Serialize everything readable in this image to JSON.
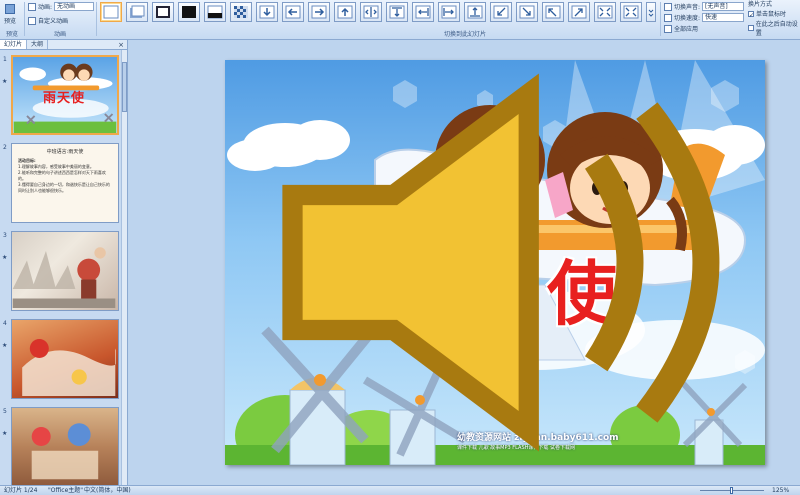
{
  "ribbon": {
    "preview_label": "预览",
    "preview_group": "预览",
    "animations_group": "动画",
    "animate_label": "动画:",
    "animate_value": "无动画",
    "custom_animation_label": "自定义动画",
    "transitions_group": "切换到此幻灯片",
    "sound_label": "切换声音:",
    "sound_value": "[无声音]",
    "speed_label": "切换速度:",
    "speed_value": "快速",
    "apply_all_label": "全部应用",
    "advance_label": "换片方式",
    "on_click_label": "单击鼠标时",
    "after_label": "在此之后自动设置"
  },
  "panel": {
    "tab_slides": "幻灯片",
    "tab_outline": "大纲",
    "close_glyph": "×",
    "slides": [
      {
        "num": "1",
        "title": "雨天使",
        "selected": true
      },
      {
        "num": "2",
        "title": "中班语言:雨天使",
        "lines": [
          "活动目标:",
          "1.理解故事内容，感受故事中美丽的变意。",
          "2.能听和完整的句子讲述西西是怎样对天下雨喜欢的。",
          "3.懂得要自己身边的一切，和谐快乐是让自己快乐的同时让别人也能够很快乐。"
        ]
      },
      {
        "num": "3"
      },
      {
        "num": "4"
      },
      {
        "num": "5"
      }
    ],
    "star_glyph": "★"
  },
  "slide": {
    "title": "雨天使",
    "watermark": "幼教资源网站 ziyuan.baby611.com",
    "watermark_sub": "课件下载  儿歌  故事MP3  FLASH课件下载  试卷下载网"
  },
  "status": {
    "slide_counter": "幻灯片 1/24",
    "theme": "\"Office主题\"",
    "language": "中文(简体，中国)",
    "zoom": "125%"
  },
  "colors": {
    "title_red": "#e8201f",
    "ribbon_bg": "#d5e4f6",
    "selection_orange": "#f0a84a"
  }
}
